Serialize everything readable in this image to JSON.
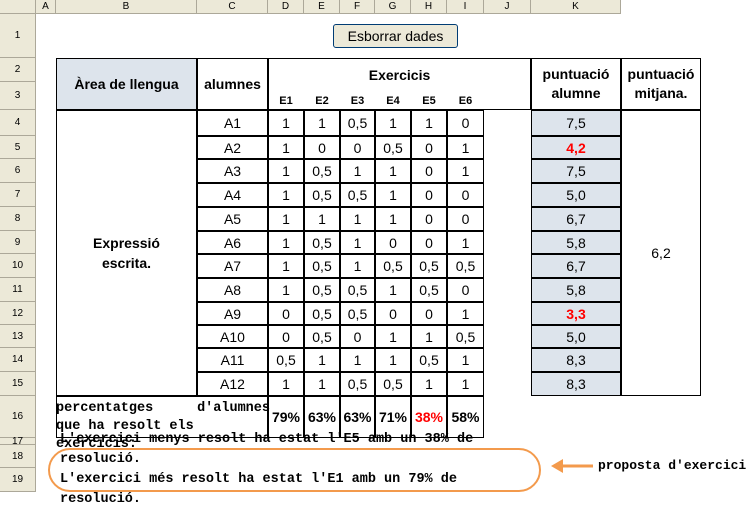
{
  "columns": [
    "A",
    "B",
    "C",
    "D",
    "E",
    "F",
    "G",
    "H",
    "I",
    "J",
    "K"
  ],
  "rows": [
    "1",
    "2",
    "3",
    "4",
    "5",
    "6",
    "7",
    "8",
    "9",
    "10",
    "11",
    "12",
    "13",
    "14",
    "15",
    "16",
    "17",
    "18",
    "19"
  ],
  "button_label": "Esborrar dades",
  "header": {
    "area": "Àrea de llengua",
    "students": "alumnes",
    "exercises": "Exercicis",
    "ex_names": [
      "E1",
      "E2",
      "E3",
      "E4",
      "E5",
      "E6"
    ],
    "score_student": "puntuació alumne",
    "score_avg": "puntuació mitjana."
  },
  "section_label": "Expressió escrita.",
  "average": "6,2",
  "students": [
    {
      "name": "A1",
      "scores": [
        "1",
        "1",
        "0,5",
        "1",
        "1",
        "0"
      ],
      "total": "7,5",
      "low": false
    },
    {
      "name": "A2",
      "scores": [
        "1",
        "0",
        "0",
        "0,5",
        "0",
        "1"
      ],
      "total": "4,2",
      "low": true
    },
    {
      "name": "A3",
      "scores": [
        "1",
        "0,5",
        "1",
        "1",
        "0",
        "1"
      ],
      "total": "7,5",
      "low": false
    },
    {
      "name": "A4",
      "scores": [
        "1",
        "0,5",
        "0,5",
        "1",
        "0",
        "0"
      ],
      "total": "5,0",
      "low": false
    },
    {
      "name": "A5",
      "scores": [
        "1",
        "1",
        "1",
        "1",
        "0",
        "0"
      ],
      "total": "6,7",
      "low": false
    },
    {
      "name": "A6",
      "scores": [
        "1",
        "0,5",
        "1",
        "0",
        "0",
        "1"
      ],
      "total": "5,8",
      "low": false
    },
    {
      "name": "A7",
      "scores": [
        "1",
        "0,5",
        "1",
        "0,5",
        "0,5",
        "0,5"
      ],
      "total": "6,7",
      "low": false
    },
    {
      "name": "A8",
      "scores": [
        "1",
        "0,5",
        "0,5",
        "1",
        "0,5",
        "0"
      ],
      "total": "5,8",
      "low": false
    },
    {
      "name": "A9",
      "scores": [
        "0",
        "0,5",
        "0,5",
        "0",
        "0",
        "1"
      ],
      "total": "3,3",
      "low": true
    },
    {
      "name": "A10",
      "scores": [
        "0",
        "0,5",
        "0",
        "1",
        "1",
        "0,5"
      ],
      "total": "5,0",
      "low": false
    },
    {
      "name": "A11",
      "scores": [
        "0,5",
        "1",
        "1",
        "1",
        "0,5",
        "1"
      ],
      "total": "8,3",
      "low": false
    },
    {
      "name": "A12",
      "scores": [
        "1",
        "1",
        "0,5",
        "0,5",
        "1",
        "1"
      ],
      "total": "8,3",
      "low": false
    }
  ],
  "pct_label_line1_a": "percentatges",
  "pct_label_line1_b": "d'alumnes",
  "pct_label_line2": "que ha resolt els exercicis:",
  "percentages": [
    "79%",
    "63%",
    "63%",
    "71%",
    "38%",
    "58%"
  ],
  "lowest_pct_index": 4,
  "note_line1": "L'exercici menys resolt ha estat l'E5 amb un 38% de resolució.",
  "note_line2": "L'exercici més resolt ha estat l'E1 amb un 79% de resolució.",
  "proposal_label": "proposta d'exercici",
  "colors": {
    "shade": "#dde4ec",
    "header_shade": "#dde4ec",
    "red": "#ff0000",
    "arrow": "#f39a4c"
  }
}
